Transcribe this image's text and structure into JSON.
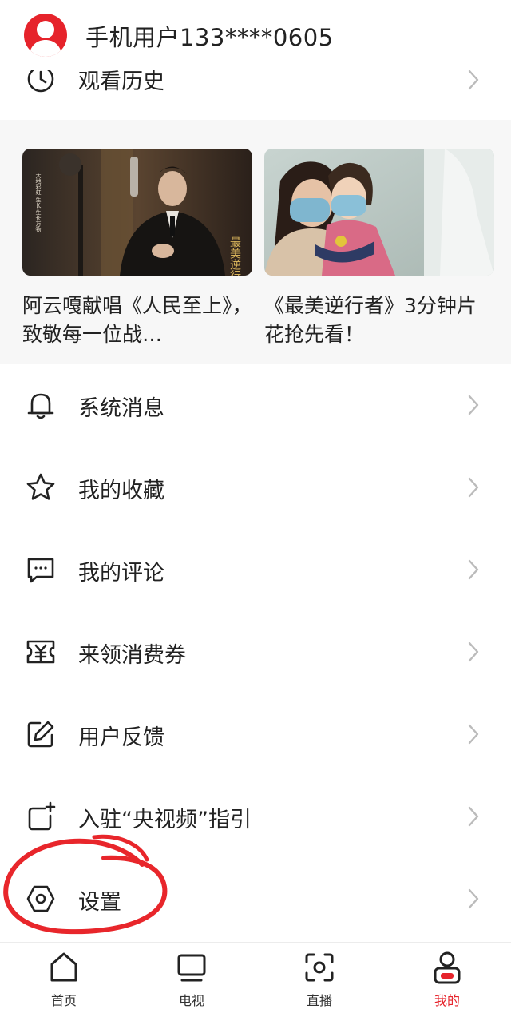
{
  "header": {
    "username": "手机用户133****0605"
  },
  "history": {
    "label": "观看历史"
  },
  "media_cards": [
    {
      "title": "阿云嘎献唱《人民至上》，致敬每一位战…",
      "poster_text": "最美逆行者",
      "side_text": "大地彩虹 生长 生长万物"
    },
    {
      "title": "《最美逆行者》3分钟片花抢先看！"
    }
  ],
  "menu": {
    "items": [
      {
        "label": "系统消息",
        "icon": "bell-icon"
      },
      {
        "label": "我的收藏",
        "icon": "star-icon"
      },
      {
        "label": "我的评论",
        "icon": "comment-icon"
      },
      {
        "label": "来领消费券",
        "icon": "coupon-icon"
      },
      {
        "label": "用户反馈",
        "icon": "edit-icon"
      },
      {
        "label": "入驻“央视频”指引",
        "icon": "add-square-icon"
      },
      {
        "label": "设置",
        "icon": "settings-icon"
      }
    ]
  },
  "tabbar": {
    "tabs": [
      {
        "label": "首页",
        "icon": "home-icon",
        "active": false
      },
      {
        "label": "电视",
        "icon": "tv-icon",
        "active": false
      },
      {
        "label": "直播",
        "icon": "live-icon",
        "active": false
      },
      {
        "label": "我的",
        "icon": "profile-icon",
        "active": true
      }
    ]
  },
  "colors": {
    "accent": "#e6232b",
    "text": "#222222",
    "panel_bg": "#f7f7f7",
    "chevron": "#bbbbbb",
    "annotation": "#e8262b"
  }
}
